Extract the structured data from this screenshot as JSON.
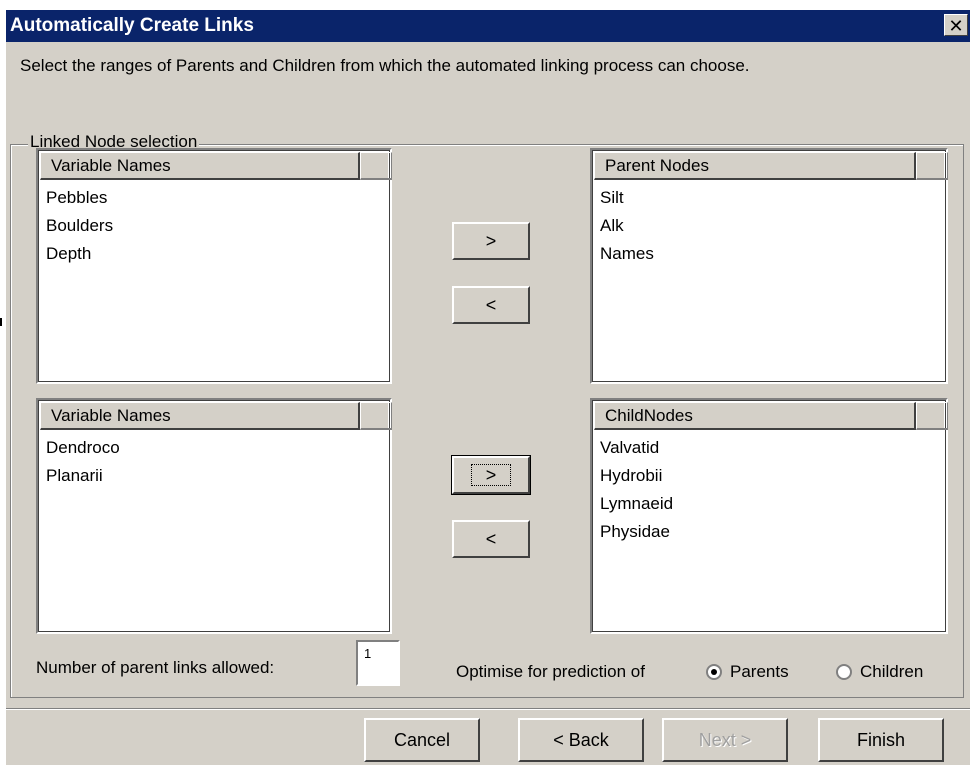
{
  "dialog": {
    "title": "Automatically Create Links",
    "close_glyph": "✕",
    "instructions": "Select the ranges of Parents and Children from which the automated linking process can choose."
  },
  "group": {
    "legend": "Linked Node selection"
  },
  "parent_source": {
    "header": "Variable Names",
    "items": [
      "Pebbles",
      "Boulders",
      "Depth"
    ]
  },
  "parent_target": {
    "header": "Parent Nodes",
    "items": [
      "Silt",
      "Alk",
      "Names"
    ]
  },
  "child_source": {
    "header": "Variable Names",
    "items": [
      "Dendroco",
      "Planarii"
    ]
  },
  "child_target": {
    "header": "ChildNodes",
    "items": [
      "Valvatid",
      "Hydrobii",
      "Lymnaeid",
      "Physidae"
    ]
  },
  "transfer": {
    "add_label": ">",
    "remove_label": "<"
  },
  "options": {
    "parent_links_label": "Number of parent links allowed:",
    "parent_links_value": "1",
    "optimise_label": "Optimise for prediction of",
    "radio_parents": "Parents",
    "radio_children": "Children",
    "selected": "Parents"
  },
  "footer": {
    "cancel": "Cancel",
    "back": "< Back",
    "next": "Next >",
    "finish": "Finish"
  }
}
